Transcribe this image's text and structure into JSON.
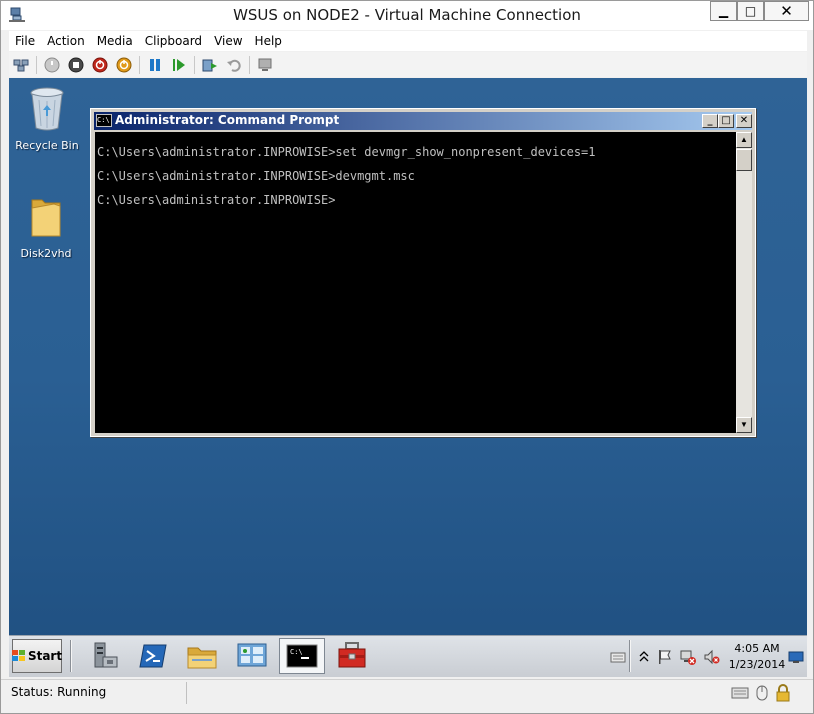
{
  "window": {
    "title": "WSUS on NODE2 - Virtual Machine Connection",
    "controls": {
      "minimize": "▁",
      "maximize": "□",
      "close": "✕"
    }
  },
  "menu": [
    "File",
    "Action",
    "Media",
    "Clipboard",
    "View",
    "Help"
  ],
  "toolbar": {
    "icons": [
      "ctrl-alt-del-icon",
      "start-vm-icon",
      "turn-off-icon",
      "shut-down-icon",
      "power-icon",
      "pause-icon",
      "resume-icon",
      "checkpoint-icon",
      "revert-icon",
      "enhanced-session-icon"
    ]
  },
  "desktop": {
    "icons": [
      {
        "label": "Recycle Bin",
        "icon": "recycle-bin-icon"
      },
      {
        "label": "Disk2vhd",
        "icon": "folder-icon"
      }
    ]
  },
  "cmd": {
    "title": "Administrator: Command Prompt",
    "lines": [
      "C:\\Users\\administrator.INPROWISE>set devmgr_show_nonpresent_devices=1",
      "C:\\Users\\administrator.INPROWISE>devmgmt.msc",
      "C:\\Users\\administrator.INPROWISE>"
    ]
  },
  "taskbar": {
    "start_label": "Start",
    "pinned": [
      "server-manager-icon",
      "powershell-icon",
      "file-explorer-icon",
      "control-panel-icon",
      "command-prompt-icon",
      "toolbox-icon"
    ],
    "active_index": 4,
    "clock": {
      "time": "4:05 AM",
      "date": "1/23/2014"
    }
  },
  "status": {
    "text": "Status: Running"
  },
  "colors": {
    "desktop": "#2a5f93",
    "titlebar_start": "#0a246a",
    "titlebar_end": "#a6caf0",
    "console": "#000000",
    "console_text": "#c0c0c0"
  }
}
